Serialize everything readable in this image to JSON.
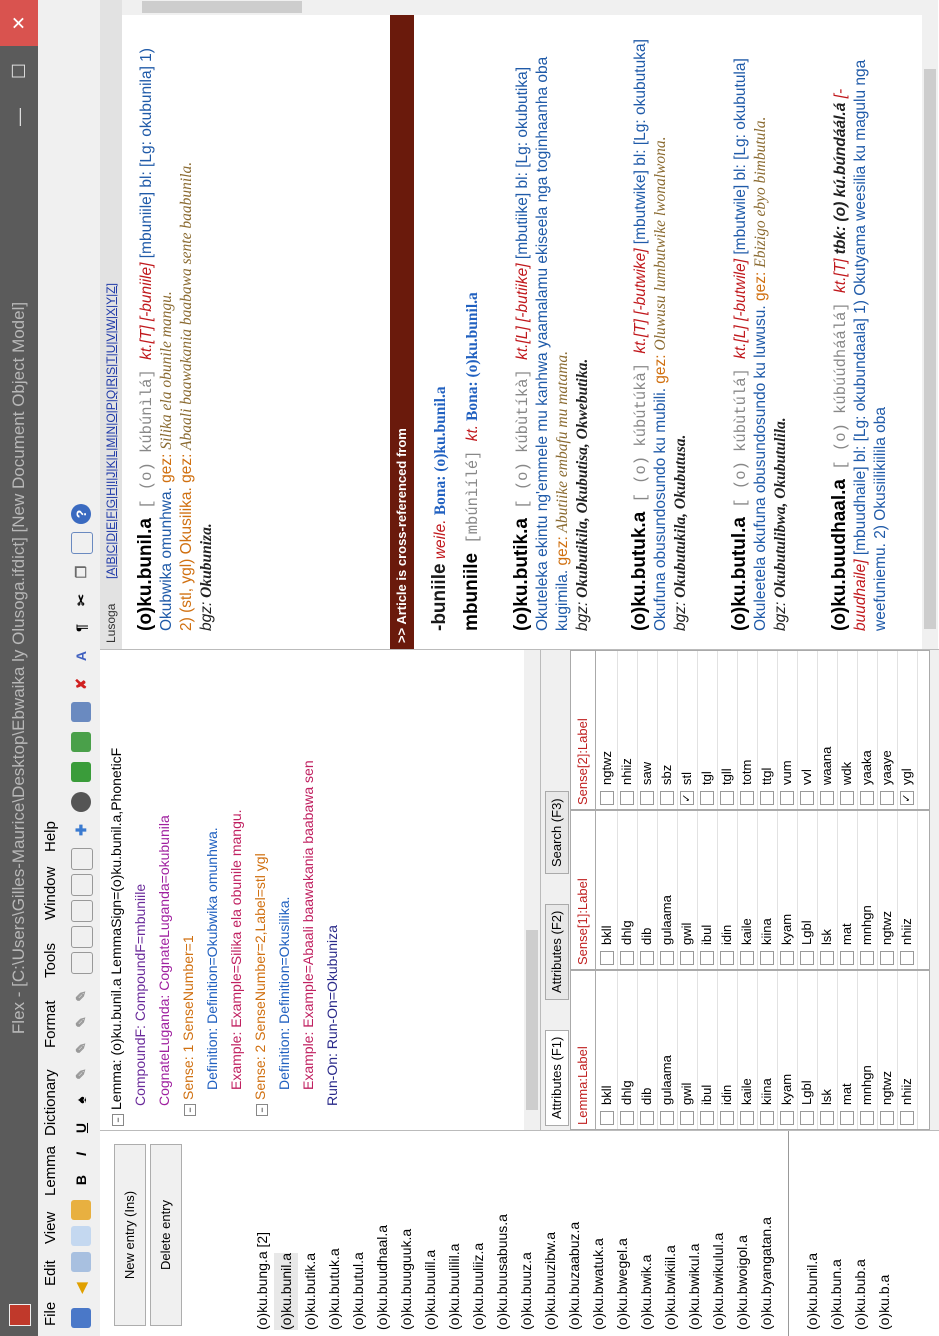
{
  "window": {
    "title": "Flex - [C:\\Users\\Gilles-Maurice\\Desktop\\Ebwaika ly Olusoga.ifdict] [New Document Object Model]"
  },
  "menu": [
    "File",
    "Edit",
    "View",
    "Lemma",
    "Dictionary",
    "Format",
    "Tools",
    "Window",
    "Help"
  ],
  "toolbar": {
    "bold": "B",
    "italic": "I",
    "underline": "U"
  },
  "left": {
    "new_entry": "New entry (Ins)",
    "delete_entry": "Delete entry",
    "entries": [
      "(o)ku.bung.a [2]",
      "(o)ku.bunil.a",
      "(o)ku.butik.a",
      "(o)ku.butuk.a",
      "(o)ku.butul.a",
      "(o)ku.buudhaal.a",
      "(o)ku.buuguuk.a",
      "(o)ku.buulil.a",
      "(o)ku.buulilil.a",
      "(o)ku.buuliiz.a",
      "(o)ku.buusabuus.a",
      "(o)ku.buuz.a",
      "(o)ku.buuzibw.a",
      "(o)ku.buzaabuz.a",
      "(o)ku.bwatuk.a",
      "(o)ku.bwegel.a",
      "(o)ku.bwik.a",
      "(o)ku.bwikiil.a",
      "(o)ku.bwikul.a",
      "(o)ku.bwikulul.a",
      "(o)ku.bwoigol.a",
      "(o)ku.byangatan.a"
    ],
    "entries2": [
      "(o)ku.bunil.a",
      "(o)ku.bun.a",
      "(o)ku.bub.a",
      "(o)ku.b.a"
    ]
  },
  "tree": {
    "lines": [
      "Lemma: (o)ku.bunil.a  LemmaSign=(o)ku.bunil.a,PhoneticF",
      "CompoundF:  CompoundF=mbuniile",
      "CognateLuganda:  CognateLuganda=okubunila",
      "Sense: 1  SenseNumber=1",
      "Definition:  Definition=Okubwika omunhwa.",
      "Example:  Example=Silika ela obunile mangu.",
      "Sense: 2  SenseNumber=2,Label=stl ygl",
      "Definition:  Definition=Okusilika.",
      "Example:  Example=Abaali baawakania baabawa sen",
      "Run-On:  Run-On=Okubuniza"
    ]
  },
  "tabs": [
    "Attributes (F1)",
    "Attributes (F2)",
    "Search (F3)"
  ],
  "grids": {
    "g1": {
      "header": "Lemma:Label",
      "rows": [
        "bkll",
        "dhlg",
        "dib",
        "gulaama",
        "gwil",
        "ibul",
        "idin",
        "kaile",
        "kiina",
        "kyam",
        "Lgbl",
        "lsk",
        "mat",
        "mnhgn",
        "ngtwz",
        "nhiiz"
      ]
    },
    "g2": {
      "header": "Sense[1]:Label",
      "rows": [
        "bkll",
        "dhlg",
        "dib",
        "gulaama",
        "gwil",
        "ibul",
        "idin",
        "kaile",
        "kiina",
        "kyam",
        "Lgbl",
        "lsk",
        "mat",
        "mnhgn",
        "ngtwz",
        "nhiiz"
      ]
    },
    "g3": {
      "header": "Sense[2]:Label",
      "rows": [
        "ngtwz",
        "nhiiz",
        "saw",
        "sbz",
        "stl",
        "tgl",
        "tgll",
        "totm",
        "ttgl",
        "vum",
        "vvl",
        "waana",
        "wdk",
        "yaaka",
        "yaaye",
        "ygl"
      ]
    }
  },
  "article": {
    "lang": "Lusoga",
    "alphabet": "[A|B|C|D|E|F|G|H|I|J|K|L|M|N|O|P|Q|R|S|T|U|V|W|X|Y|Z]",
    "e1_hw": "(o)ku.bunil.a",
    "e1_phon": " [ (o) kúbúnìlá] ",
    "e1_kt": "kt.[T] [-buniile] ",
    "e1_b1": "[mbuniile] bl: [Lg: okubunila] 1) Okubwika omunhwa. ",
    "gez": "gez:",
    "e1_ex1": " Silika ela obunile mangu.",
    "e1_s2": "2) (stl, ygl) Okusilika. ",
    "e1_ex2": " Abaali baawakania baabawa sente baabunila.",
    "bgz": "bgz:",
    "e1_runon": " Okubuniza.",
    "xref": ">> Article is cross-referenced from",
    "x1_hw": "-buniile",
    "x1_w": " weile. ",
    "x1_bona": "Bona: (o)ku.bunil.a",
    "x2_hw": "mbuniile",
    "x2_ph": " [mbúnìílé] ",
    "x2_kt": "kt.",
    "x2_bona": " Bona: (o)ku.bunil.a",
    "e2_hw": "(o)ku.butik.a",
    "e2_phon": " [ (o) kúbùtíkà] ",
    "e2_kt": "kt.[L] [-butiike] ",
    "e2_b": "[mbutiike] bl: [Lg: okubutika] Okuteleka ekintu ng'emmele mu kanhwa yaamalamu ekiseela nga toginhaanha oba kugimila. ",
    "e2_ex": " Abutiike embafu mu matama.",
    "e2_bgz": " Okubutikila, Okubutisa, Okwebutika.",
    "e3_hw": "(o)ku.butuk.a",
    "e3_phon": " [ (o) kúbútúkà] ",
    "e3_kt": "kt.[T] [-butwike] ",
    "e3_b": "[mbutwike] bl: [Lg: okubutuka] Okufuna obusundosundo ku mubili. ",
    "e3_ex": " Oluwusu lumbutwike lwonalwona.",
    "e3_bgz": " Okubutukila, Okubutusa.",
    "e4_hw": "(o)ku.butul.a",
    "e4_phon": " [ (o) kúbùtúlá] ",
    "e4_kt": "kt.[L] [-butwile] ",
    "e4_b": "[mbutwile] bl: [Lg: okubutula] Okuleetela okufuna obusundosundo ku luwusu. ",
    "e4_ex": " Ebizigo ebyo bimbutula.",
    "e4_bgz": " Okubutulibwa, Okubutulila.",
    "e5_hw": "(o)ku.buudhaal.a",
    "e5_phon": " [ (o) kúbúúdháálá] ",
    "e5_kt": "kt.[T] ",
    "e5_tbk": "tbk: (o) kú.búndáál.á ",
    "e5_kt2": "[-buudhaile] ",
    "e5_b": "[mbuudhaile] bl: [Lg: okubundaala] 1) Okutyama weesilia ku magulu nga weefuniemu. 2) Okusiilikiilila oba"
  }
}
